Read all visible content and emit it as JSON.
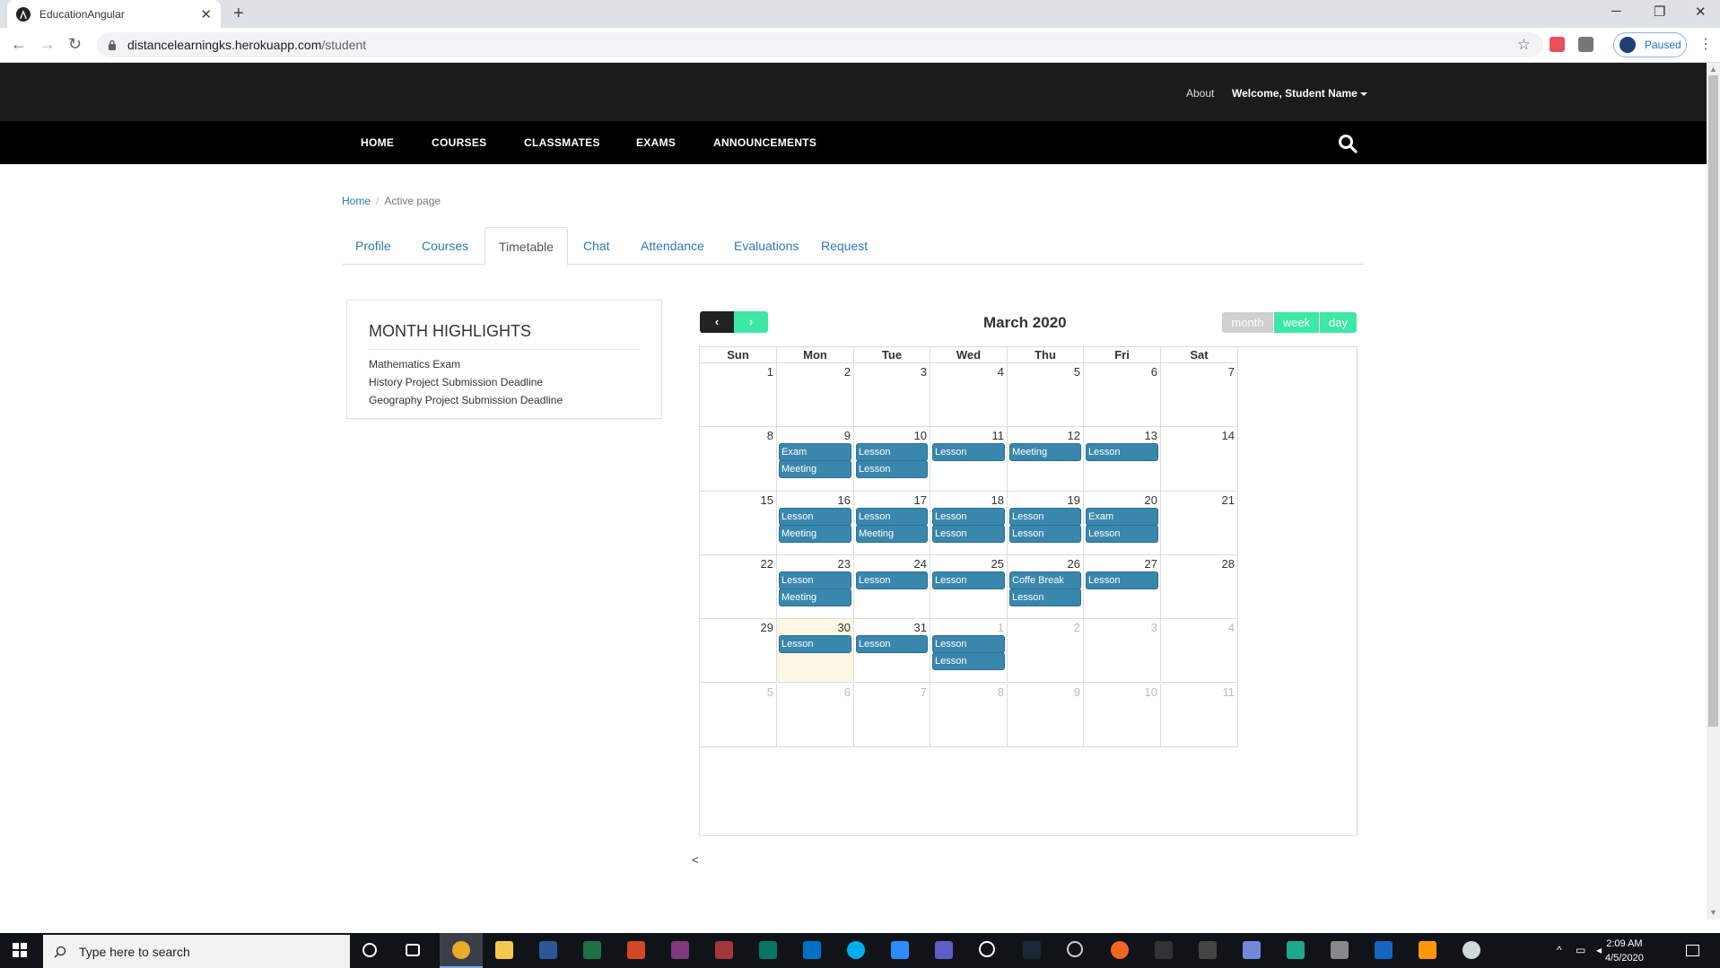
{
  "browser": {
    "tab_title": "EducationAngular",
    "url_host": "distancelearningks.herokuapp.com",
    "url_path": "/student",
    "profile_status": "Paused"
  },
  "header": {
    "about": "About",
    "welcome": "Welcome, Student Name"
  },
  "nav": {
    "items": [
      "HOME",
      "COURSES",
      "CLASSMATES",
      "EXAMS",
      "ANNOUNCEMENTS"
    ]
  },
  "breadcrumb": {
    "home": "Home",
    "separator": "/",
    "active": "Active page"
  },
  "profile_tabs": {
    "items": [
      "Profile",
      "Courses",
      "Timetable",
      "Chat",
      "Attendance",
      "Evaluations",
      "Request"
    ],
    "active": "Timetable"
  },
  "highlights": {
    "title": "MONTH HIGHLIGHTS",
    "items": [
      "Mathematics Exam",
      "History Project Submission Deadline",
      "Geography Project Submission Deadline"
    ]
  },
  "calendar": {
    "prev_label": "‹",
    "next_label": "›",
    "title": "March 2020",
    "views": [
      "month",
      "week",
      "day"
    ],
    "active_view": "month",
    "weekdays": [
      "Sun",
      "Mon",
      "Tue",
      "Wed",
      "Thu",
      "Fri",
      "Sat"
    ],
    "weeks": [
      [
        {
          "d": "1"
        },
        {
          "d": "2"
        },
        {
          "d": "3"
        },
        {
          "d": "4"
        },
        {
          "d": "5"
        },
        {
          "d": "6"
        },
        {
          "d": "7"
        }
      ],
      [
        {
          "d": "8"
        },
        {
          "d": "9",
          "ev": [
            "Exam",
            "Meeting"
          ]
        },
        {
          "d": "10",
          "ev": [
            "Lesson",
            "Lesson"
          ]
        },
        {
          "d": "11",
          "ev": [
            "Lesson"
          ]
        },
        {
          "d": "12",
          "ev": [
            "Meeting"
          ]
        },
        {
          "d": "13",
          "ev": [
            "Lesson"
          ]
        },
        {
          "d": "14"
        }
      ],
      [
        {
          "d": "15"
        },
        {
          "d": "16",
          "ev": [
            "Lesson",
            "Meeting"
          ]
        },
        {
          "d": "17",
          "ev": [
            "Lesson",
            "Meeting"
          ]
        },
        {
          "d": "18",
          "ev": [
            "Lesson",
            "Lesson"
          ]
        },
        {
          "d": "19",
          "ev": [
            "Lesson",
            "Lesson"
          ]
        },
        {
          "d": "20",
          "ev": [
            "Exam",
            "Lesson"
          ]
        },
        {
          "d": "21"
        }
      ],
      [
        {
          "d": "22"
        },
        {
          "d": "23",
          "ev": [
            "Lesson",
            "Meeting"
          ]
        },
        {
          "d": "24",
          "ev": [
            "Lesson"
          ]
        },
        {
          "d": "25",
          "ev": [
            "Lesson"
          ]
        },
        {
          "d": "26",
          "ev": [
            "Coffe Break",
            "Lesson"
          ]
        },
        {
          "d": "27",
          "ev": [
            "Lesson"
          ]
        },
        {
          "d": "28"
        }
      ],
      [
        {
          "d": "29"
        },
        {
          "d": "30",
          "today": true,
          "ev": [
            "Lesson"
          ]
        },
        {
          "d": "31",
          "ev": [
            "Lesson"
          ]
        },
        {
          "d": "1",
          "other": true,
          "ev": [
            "Lesson",
            "Lesson"
          ]
        },
        {
          "d": "2",
          "other": true
        },
        {
          "d": "3",
          "other": true
        },
        {
          "d": "4",
          "other": true
        }
      ],
      [
        {
          "d": "5",
          "other": true
        },
        {
          "d": "6",
          "other": true
        },
        {
          "d": "7",
          "other": true
        },
        {
          "d": "8",
          "other": true
        },
        {
          "d": "9",
          "other": true
        },
        {
          "d": "10",
          "other": true
        },
        {
          "d": "11",
          "other": true
        }
      ]
    ],
    "footer_text": "<"
  },
  "taskbar": {
    "search_placeholder": "Type here to search",
    "time": "2:09 AM",
    "date": "4/5/2020"
  },
  "colors": {
    "event_bg": "#3a87ad",
    "accent_green": "#3de8a6",
    "today_bg": "#fcf8e3",
    "nav_bg": "#000000"
  }
}
